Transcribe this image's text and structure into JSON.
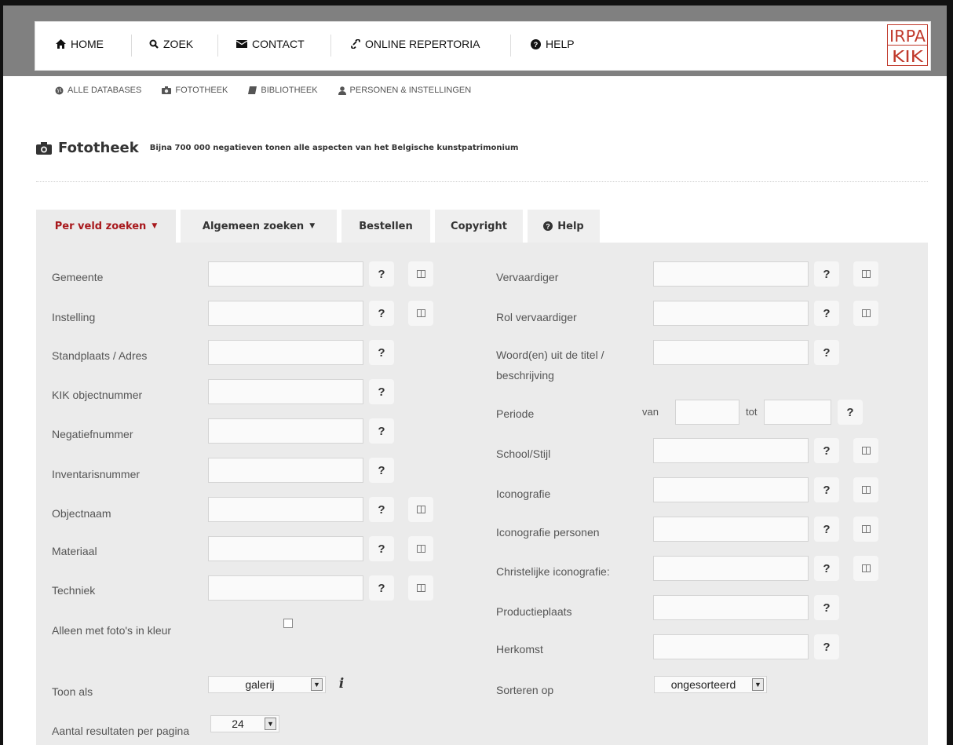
{
  "nav": {
    "home": "HOME",
    "zoek": "ZOEK",
    "contact": "CONTACT",
    "repertoria": "ONLINE REPERTORIA",
    "help": "HELP"
  },
  "logo": {
    "top": "IRPA",
    "bottom": "KIK"
  },
  "subnav": {
    "all": "ALLE DATABASES",
    "fototheek": "FOTOTHEEK",
    "bibliotheek": "BIBLIOTHEEK",
    "personen": "PERSONEN & INSTELLINGEN"
  },
  "page": {
    "title": "Fototheek",
    "subtitle": "Bijna 700 000 negatieven tonen alle aspecten van het Belgische kunstpatrimonium"
  },
  "tabs": {
    "per_veld": "Per veld zoeken",
    "algemeen": "Algemeen zoeken",
    "bestellen": "Bestellen",
    "copyright": "Copyright",
    "help": "Help"
  },
  "help_glyph": "?",
  "left_fields": {
    "gemeente": "Gemeente",
    "instelling": "Instelling",
    "standplaats": "Standplaats / Adres",
    "kik": "KIK objectnummer",
    "negatief": "Negatiefnummer",
    "inventaris": "Inventarisnummer",
    "objectnaam": "Objectnaam",
    "materiaal": "Materiaal",
    "techniek": "Techniek",
    "kleur": "Alleen met foto's in kleur",
    "toon_als": "Toon als",
    "aantal": "Aantal resultaten per pagina"
  },
  "right_fields": {
    "vervaardiger": "Vervaardiger",
    "rol": "Rol vervaardiger",
    "woorden_1": "Woord(en) uit de titel /",
    "woorden_2": "beschrijving",
    "periode": "Periode",
    "van": "van",
    "tot": "tot",
    "school": "School/Stijl",
    "iconografie": "Iconografie",
    "icon_personen": "Iconografie personen",
    "christelijke": "Christelijke iconografie:",
    "productie": "Productieplaats",
    "herkomst": "Herkomst",
    "sorteren": "Sorteren op"
  },
  "selects": {
    "toon_als": "galerij",
    "aantal": "24",
    "sorteren": "ongesorteerd"
  },
  "info_glyph": "i",
  "colors": {
    "accent": "#a8191d",
    "panel": "#ebebeb",
    "topbar": "#808080"
  }
}
